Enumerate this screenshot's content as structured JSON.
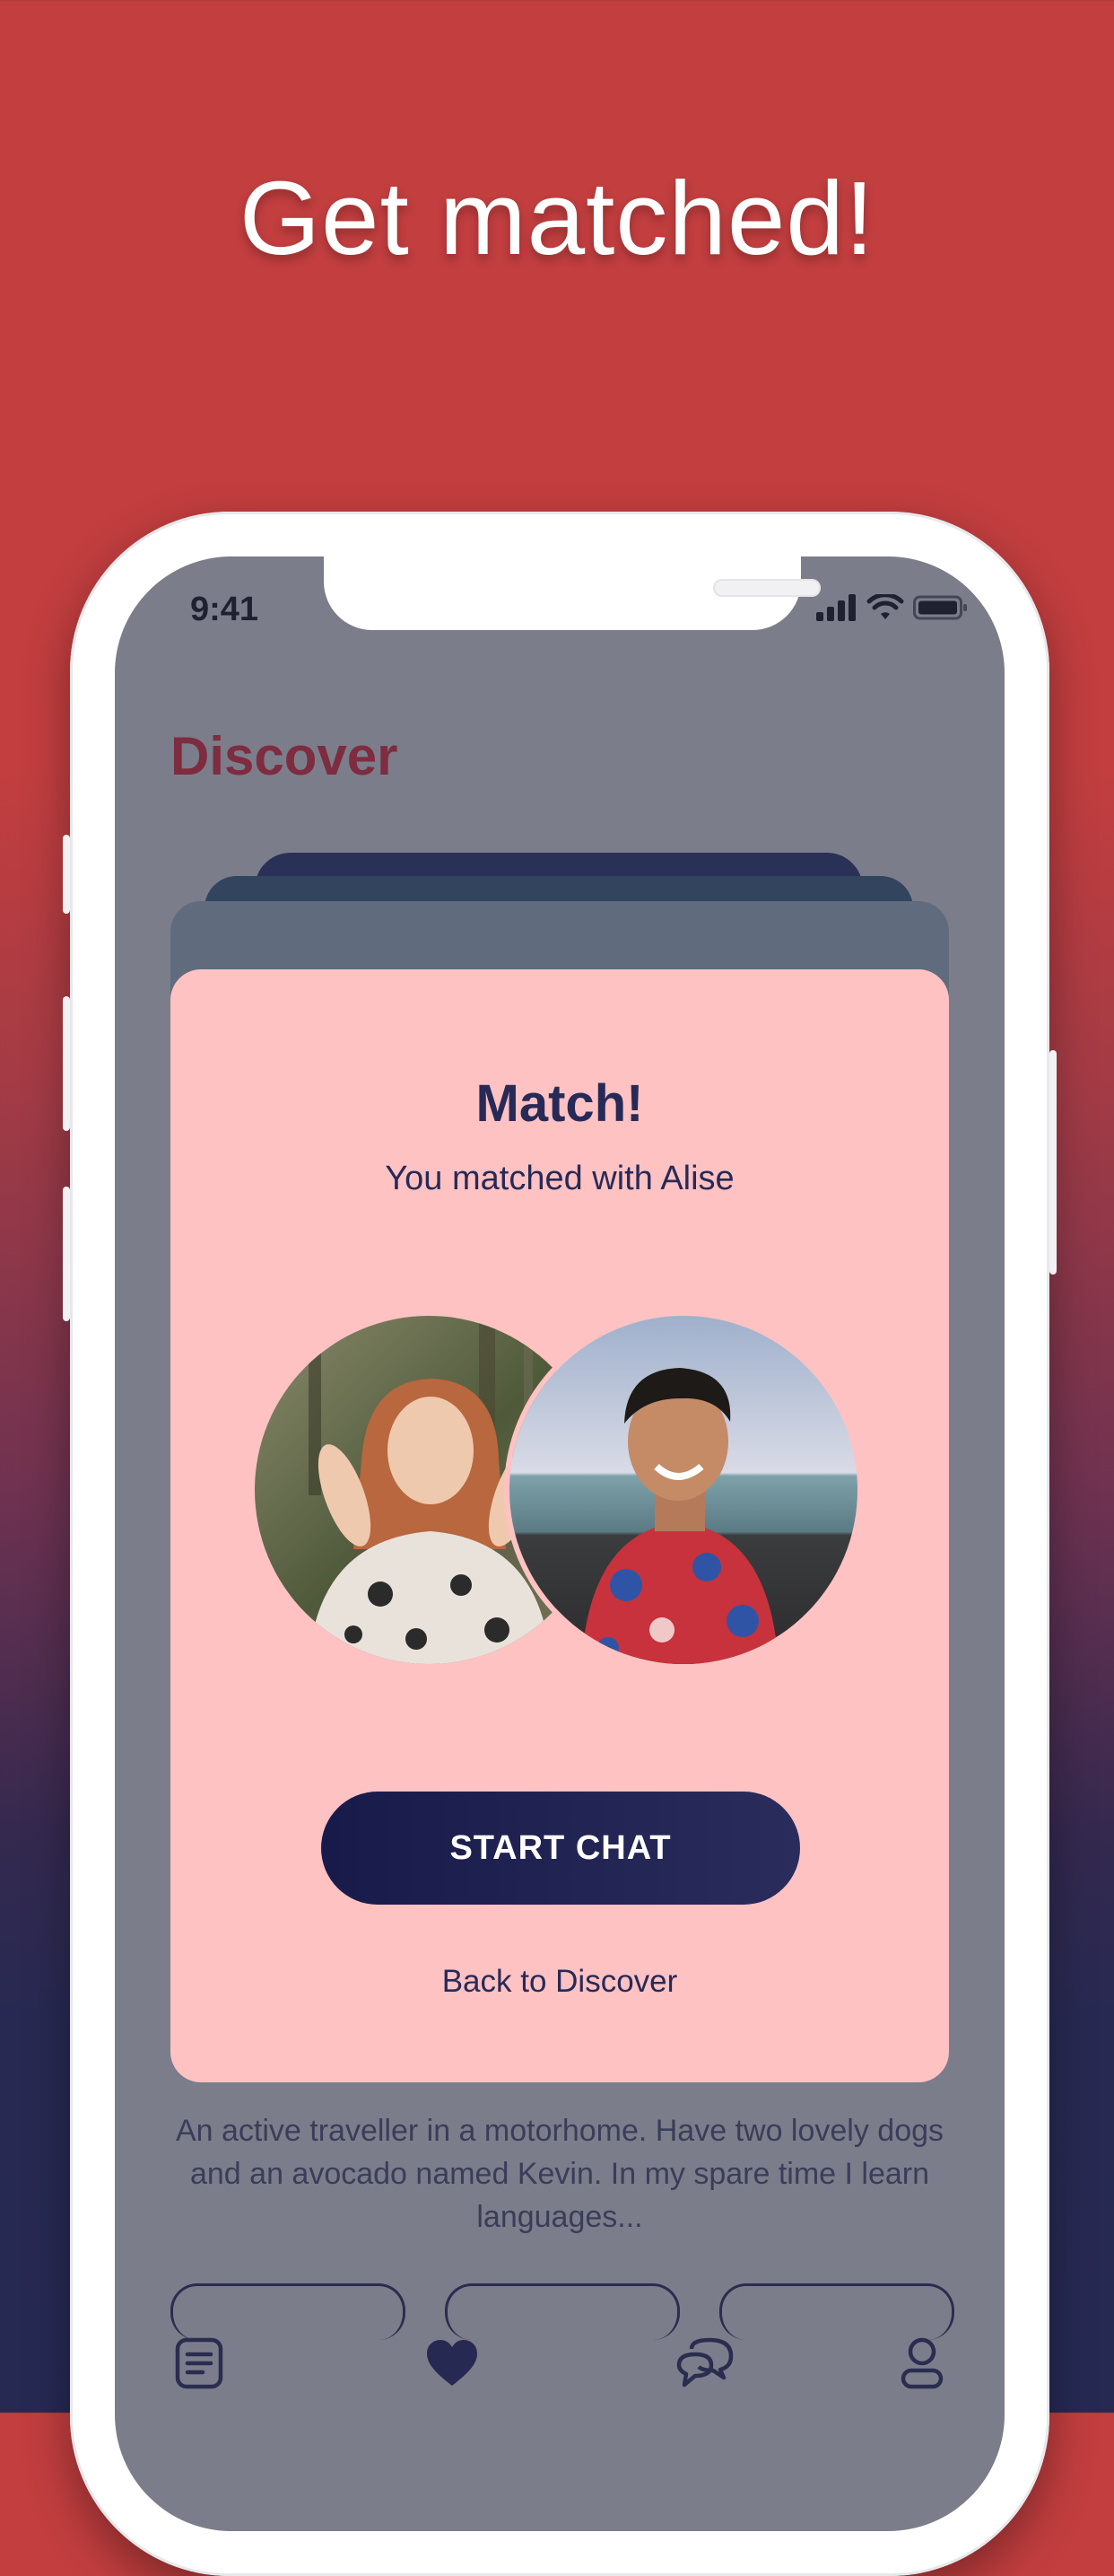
{
  "headline": "Get matched!",
  "status_bar": {
    "time": "9:41",
    "icons": [
      "signal-icon",
      "wifi-icon",
      "battery-icon"
    ]
  },
  "page": {
    "title": "Discover"
  },
  "match_card": {
    "title": "Match!",
    "subtitle": "You matched with Alise",
    "avatars": [
      "woman-avatar",
      "man-avatar"
    ],
    "primary_button": "START CHAT",
    "secondary_link": "Back to Discover"
  },
  "profile_bio": "An active traveller in a motorhome. Have two lovely dogs and an avocado named Kevin. In my spare time I learn languages...",
  "tab_bar": {
    "items": [
      {
        "icon": "feed-icon",
        "active": false
      },
      {
        "icon": "heart-icon",
        "active": true
      },
      {
        "icon": "chat-icon",
        "active": false
      },
      {
        "icon": "profile-icon",
        "active": false
      }
    ]
  },
  "colors": {
    "background_top": "#c23e3f",
    "background_bottom": "#262952",
    "accent_title": "#7e2c3f",
    "card_background": "#ffc2c3",
    "button_dark": "#181a4a"
  }
}
